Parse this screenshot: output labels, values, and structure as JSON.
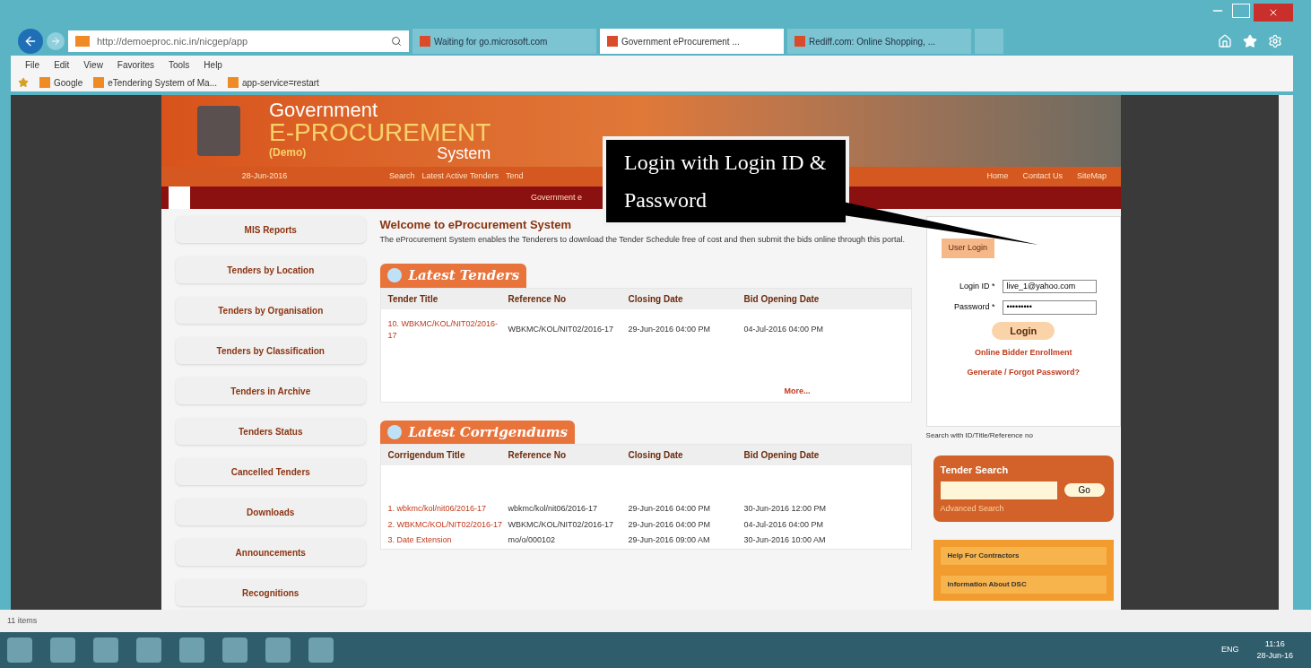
{
  "browser": {
    "address": "http://demoeproc.nic.in/nicgep/app",
    "tabs": [
      {
        "label": "Waiting for go.microsoft.com",
        "selected": false
      },
      {
        "label": "Government eProcurement ...",
        "selected": true
      },
      {
        "label": "Rediff.com: Online Shopping, ...",
        "selected": false
      }
    ],
    "menu": [
      "File",
      "Edit",
      "View",
      "Favorites",
      "Tools",
      "Help"
    ],
    "favorites": [
      "Google",
      "eTendering System of Ma...",
      "app-service=restart"
    ]
  },
  "site_header": {
    "line_1": "Government",
    "line_2": "E-PROCUREMENT",
    "line_3": "System",
    "demo": "(Demo)",
    "date": "28-Jun-2016",
    "nav": [
      "Search",
      "Latest Active Tenders",
      "Tend"
    ],
    "right_links": [
      "Home",
      "Contact Us",
      "SiteMap"
    ],
    "ticker": "Government e"
  },
  "sidebar": {
    "items": [
      "MIS Reports",
      "Tenders by Location",
      "Tenders by Organisation",
      "Tenders by Classification",
      "Tenders in Archive",
      "Tenders Status",
      "Cancelled Tenders",
      "Downloads",
      "Announcements",
      "Recognitions"
    ]
  },
  "welcome": {
    "title": "Welcome to eProcurement System",
    "text": "The eProcurement System enables the Tenderers to download the Tender Schedule free of cost and then submit the bids online through this portal."
  },
  "latest_tenders": {
    "title": "Latest Tenders",
    "columns": [
      "Tender Title",
      "Reference No",
      "Closing Date",
      "Bid Opening Date"
    ],
    "rows": [
      [
        "10. WBKMC/KOL/NIT02/2016-17",
        "WBKMC/KOL/NIT02/2016-17",
        "29-Jun-2016 04:00 PM",
        "04-Jul-2016 04:00 PM"
      ]
    ],
    "more": "More..."
  },
  "corrigendums": {
    "title": "Latest Corrigendums",
    "columns": [
      "Corrigendum Title",
      "Reference No",
      "Closing Date",
      "Bid Opening Date"
    ],
    "rows": [
      [
        "1. wbkmc/kol/nit06/2016-17",
        "wbkmc/kol/nit06/2016-17",
        "29-Jun-2016 04:00 PM",
        "30-Jun-2016 12:00 PM"
      ],
      [
        "2. WBKMC/KOL/NIT02/2016-17",
        "WBKMC/KOL/NIT02/2016-17",
        "29-Jun-2016 04:00 PM",
        "04-Jul-2016 04:00 PM"
      ],
      [
        "3. Date Extension",
        "mo/o/000102",
        "29-Jun-2016 09:00 AM",
        "30-Jun-2016 10:00 AM"
      ]
    ]
  },
  "login": {
    "tab": "User Login",
    "id_label": "Login ID *",
    "id_value": "live_1@yahoo.com",
    "password_label": "Password *",
    "password_value": "•••••••••",
    "button": "Login",
    "links": [
      "Online Bidder Enrollment",
      "Generate / Forgot Password?"
    ]
  },
  "search_hint": "Search with ID/Title/Reference no",
  "tender_search": {
    "title": "Tender Search",
    "button": "Go",
    "link": "Advanced Search"
  },
  "help_panels": [
    "Help For Contractors",
    "Information About DSC"
  ],
  "callout": "Login with Login ID & Password",
  "status_bar": {
    "text": "11 items"
  },
  "taskbar": {
    "language": "ENG",
    "time": "11:16",
    "date": "28-Jun-16"
  }
}
